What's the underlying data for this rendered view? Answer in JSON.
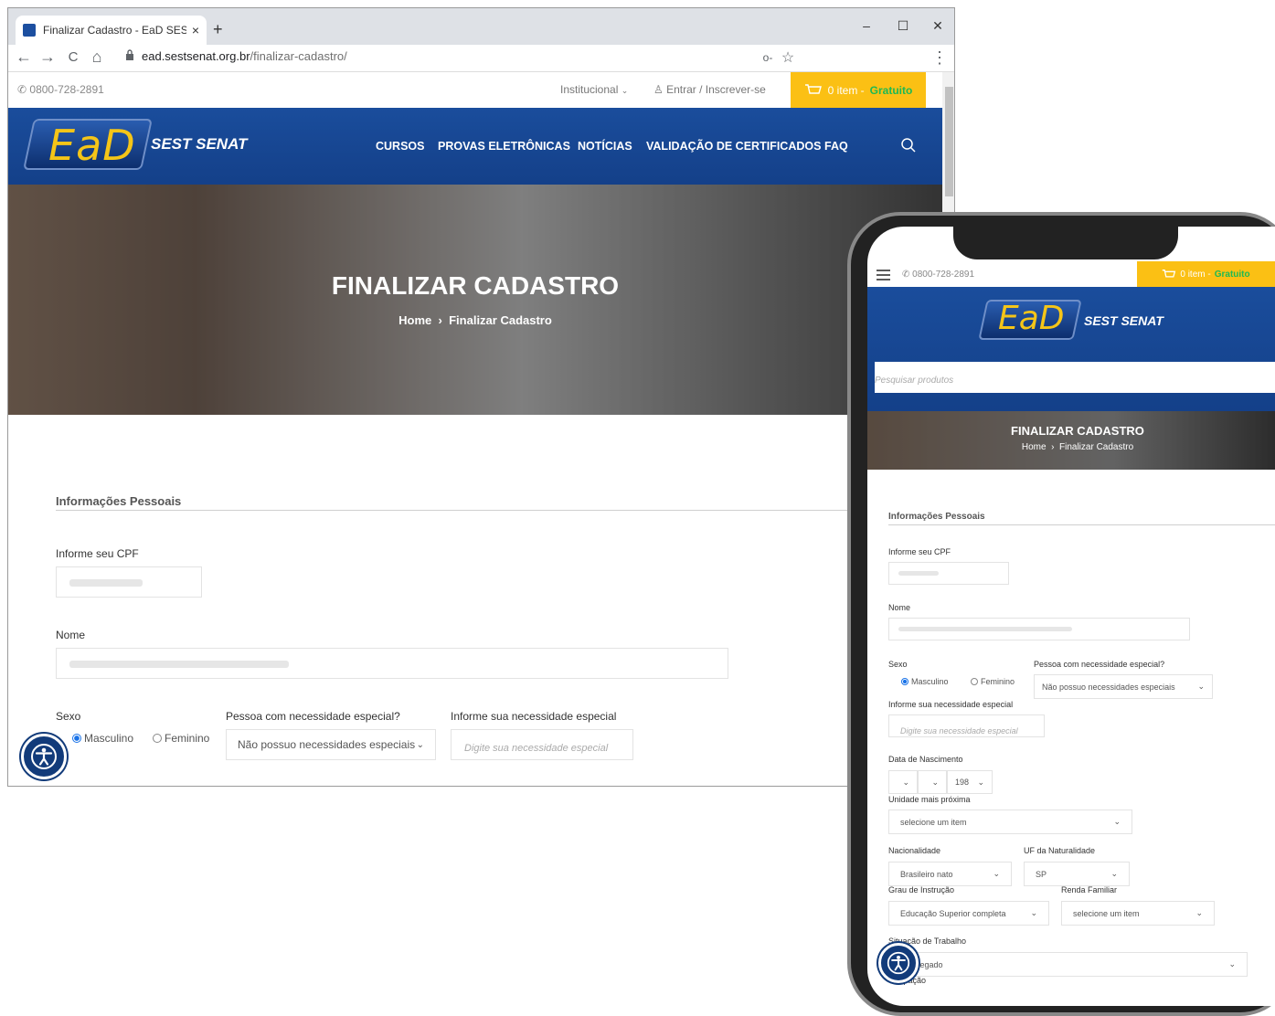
{
  "browser": {
    "tab_title": "Finalizar Cadastro - EaD SEST SE",
    "tab_close": "×",
    "new_tab": "+",
    "url_domain": "ead.sestsenat.org.br",
    "url_path": "/finalizar-cadastro/",
    "minimize": "–",
    "maximize": "☐",
    "close": "✕",
    "back": "←",
    "forward": "→",
    "reload": "C",
    "home": "⌂",
    "key_icon": "o‑",
    "star": "☆",
    "menu_dots": "⋮"
  },
  "topbar": {
    "phone": "0800-728-2891",
    "institutional": "Institucional",
    "login": "Entrar / Inscrever-se",
    "cart_items": "0 item -",
    "cart_free": "Gratuito"
  },
  "header": {
    "logo_ead": "EaD",
    "logo_sestsenat": "SEST SENAT",
    "menu": [
      "CURSOS",
      "PROVAS ELETRÔNICAS",
      "NOTÍCIAS",
      "VALIDAÇÃO DE CERTIFICADOS",
      "FAQ"
    ]
  },
  "hero": {
    "title": "FINALIZAR CADASTRO",
    "crumb_home": "Home",
    "crumb_sep": "›",
    "crumb_current": "Finalizar Cadastro"
  },
  "form": {
    "section_title": "Informações Pessoais",
    "cpf_label": "Informe seu CPF",
    "name_label": "Nome",
    "sex_label": "Sexo",
    "sex_male": "Masculino",
    "sex_female": "Feminino",
    "special_label": "Pessoa com necessidade especial?",
    "special_value": "Não possuo necessidades especiais",
    "special_detail_label": "Informe sua necessidade especial",
    "special_detail_placeholder": "Digite sua necessidade especial",
    "birth_label": "Data de Nascimento",
    "birth_year": "198",
    "unit_label": "Unidade mais próxima",
    "unit_value": "selecione um item",
    "nationality_label": "Nacionalidade",
    "nationality_value": "Brasileiro nato",
    "uf_label": "UF da Naturalidade",
    "uf_value": "SP",
    "education_label": "Grau de Instrução",
    "education_value": "Educação Superior completa",
    "income_label": "Renda Familiar",
    "income_value": "selecione um item",
    "work_label": "Situação de Trabalho",
    "work_value": "Empregado",
    "occupation_label": "Ocupação"
  },
  "mobile": {
    "search_placeholder": "Pesquisar produtos"
  },
  "colors": {
    "brand_blue": "#1a4d9c",
    "cart_yellow": "#fbc014",
    "free_green": "#1db954",
    "logo_gold": "#f5c518"
  },
  "icons": {
    "accessibility": "accessibility-icon",
    "search": "search-icon",
    "cart": "cart-icon",
    "phone": "phone-icon",
    "user": "user-icon",
    "hamburger": "hamburger-icon",
    "chevron": "chevron-down-icon"
  }
}
